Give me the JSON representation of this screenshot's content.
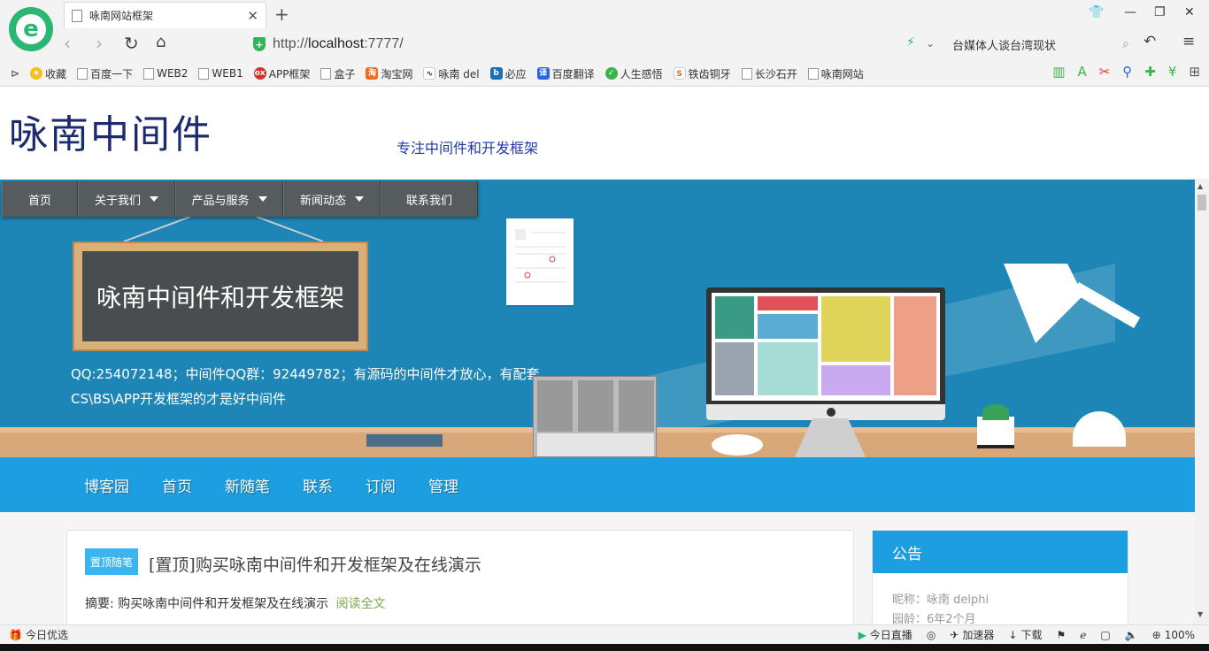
{
  "browser": {
    "tab_title": "咏南网站框架",
    "tab_close": "✕",
    "new_tab": "+",
    "url_prefix": "http://",
    "url_host": "localhost",
    "url_rest": ":7777/",
    "search_query": "台媒体人谈台湾现状",
    "bookmarks": [
      {
        "label": "收藏",
        "icon": "star-icon"
      },
      {
        "label": "百度一下",
        "icon": "page-icon"
      },
      {
        "label": "WEB2",
        "icon": "page-icon"
      },
      {
        "label": "WEB1",
        "icon": "page-icon"
      },
      {
        "label": "APP框架",
        "icon": "red-badge-icon"
      },
      {
        "label": "盒子",
        "icon": "page-icon"
      },
      {
        "label": "淘宝网",
        "icon": "taobao-icon"
      },
      {
        "label": "咏南 del",
        "icon": "delphi-icon"
      },
      {
        "label": "必应",
        "icon": "bing-icon"
      },
      {
        "label": "百度翻译",
        "icon": "translate-icon"
      },
      {
        "label": "人生感悟",
        "icon": "check-icon"
      },
      {
        "label": "铁齿铜牙",
        "icon": "soku-icon"
      },
      {
        "label": "长沙石开",
        "icon": "page-icon"
      },
      {
        "label": "咏南网站",
        "icon": "page-icon"
      }
    ]
  },
  "header": {
    "site_title": "咏南中间件",
    "slogan": "专注中间件和开发框架"
  },
  "topnav": [
    {
      "label": "首页",
      "dropdown": false
    },
    {
      "label": "关于我们",
      "dropdown": true
    },
    {
      "label": "产品与服务",
      "dropdown": true
    },
    {
      "label": "新闻动态",
      "dropdown": true
    },
    {
      "label": "联系我们",
      "dropdown": false
    }
  ],
  "banner": {
    "board_text": "咏南中间件和开发框架",
    "text": "QQ:254072148；中间件QQ群：92449782；有源码的中间件才放心，有配套CS\\BS\\APP开发框架的才是好中间件"
  },
  "blognav": [
    "博客园",
    "首页",
    "新随笔",
    "联系",
    "订阅",
    "管理"
  ],
  "post": {
    "badge": "置顶随笔",
    "title": "[置顶]购买咏南中间件和开发框架及在线演示",
    "summary": "摘要: 购买咏南中间件和开发框架及在线演示",
    "read_more": "阅读全文"
  },
  "sidebar": {
    "heading": "公告",
    "nickname": "昵称：咏南 delphi",
    "age": "园龄：6年2个月"
  },
  "status": {
    "left": "今日优选",
    "live": "今日直播",
    "accelerator": "加速器",
    "download": "下载",
    "zoom": "100%"
  },
  "colors": {
    "banner_blue": "#1d86b6",
    "blog_blue": "#1c9ee0",
    "title_navy": "#1c2a6e",
    "logo_green": "#2bb673"
  }
}
